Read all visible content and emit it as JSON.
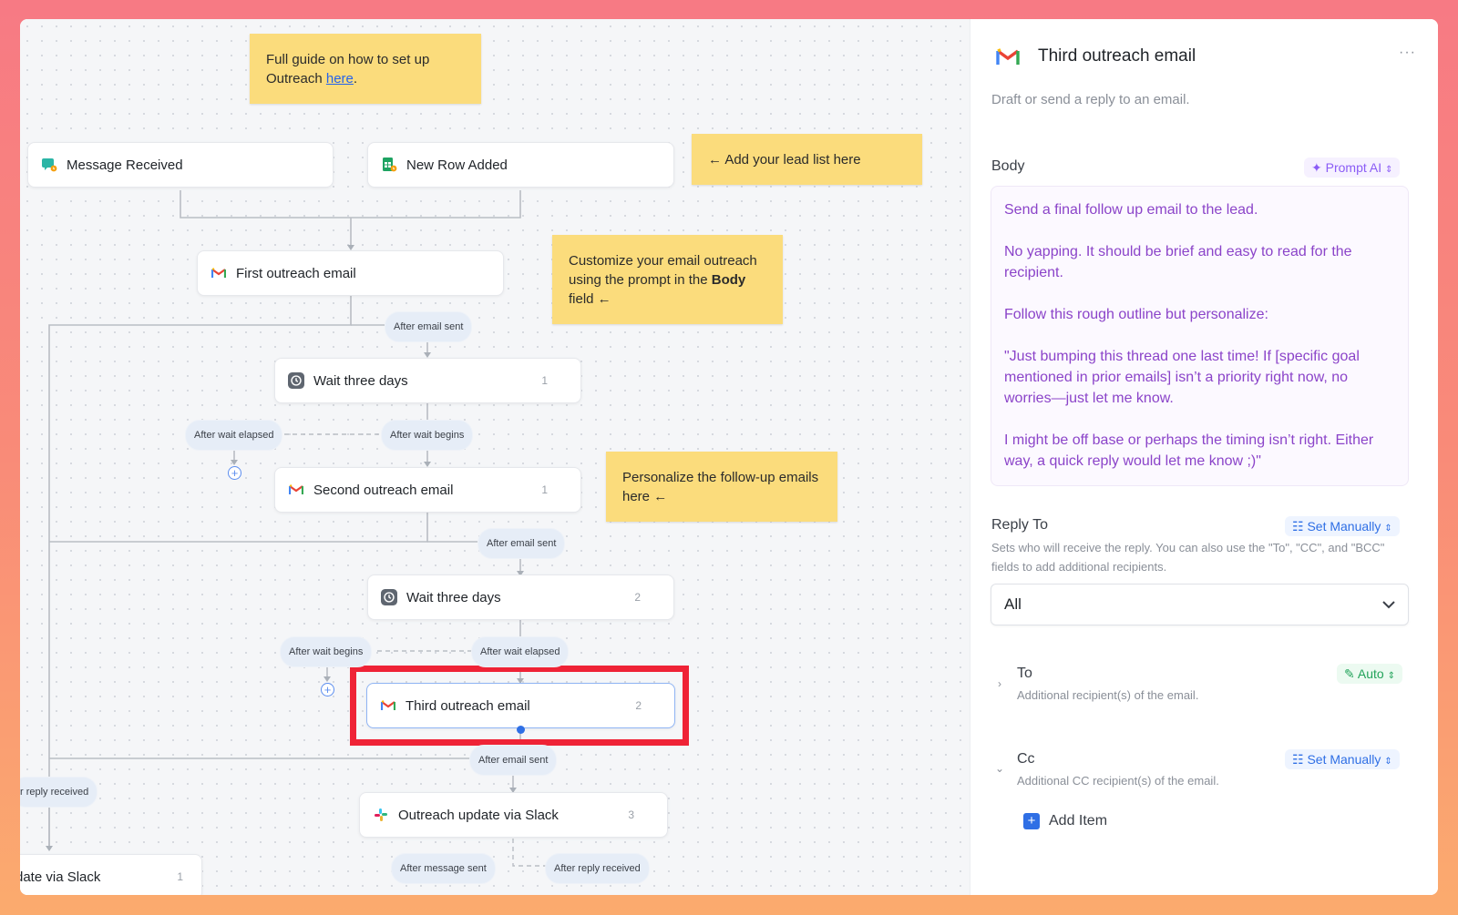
{
  "notes": {
    "guide_text": "Full guide on how to set up Outreach",
    "guide_link": "here",
    "guide_period": ".",
    "lead_list": "← Add your lead list here",
    "customize_pre": "Customize your email outreach using the prompt in the",
    "customize_bold": "Body",
    "customize_post": "field ←",
    "personalize": "Personalize the follow-up emails here ←"
  },
  "nodes": {
    "message_received": "Message Received",
    "new_row_added": "New Row Added",
    "first_outreach": "First outreach email",
    "wait1": "Wait three days",
    "wait1_count": "1",
    "second_outreach": "Second outreach email",
    "second_count": "1",
    "wait2": "Wait three days",
    "wait2_count": "2",
    "third_outreach": "Third outreach email",
    "third_count": "2",
    "slack_update": "Outreach update via Slack",
    "slack_count": "3",
    "slack_partial": "date via Slack",
    "slack_partial_count": "1"
  },
  "pills": {
    "after_email_sent": "After email sent",
    "after_wait_elapsed": "After wait elapsed",
    "after_wait_begins": "After wait begins",
    "reply_received_partial": "r reply received",
    "after_message_sent": "After message sent",
    "after_reply_received": "After reply received"
  },
  "panel": {
    "title": "Third outreach email",
    "more": "···",
    "description": "Draft or send a reply to an email.",
    "body_label": "Body",
    "prompt_ai": "Prompt AI",
    "body_lines": [
      "Send a final follow up email to the lead.",
      "No yapping. It should be brief and easy to read for the recipient.",
      "Follow this rough outline but personalize:",
      "\"Just bumping this thread one last time! If [specific goal mentioned in prior emails] isn’t a priority right now, no worries—just let me know.",
      "I might be off base or perhaps the timing isn’t right. Either way, a quick reply would let me know ;)\""
    ],
    "reply_to_label": "Reply To",
    "set_manually": "Set Manually",
    "reply_to_help": "Sets who will receive the reply. You can also use the \"To\", \"CC\", and \"BCC\" fields to add additional recipients.",
    "reply_to_value": "All",
    "to_label": "To",
    "auto": "Auto",
    "to_help": "Additional recipient(s) of the email.",
    "cc_label": "Cc",
    "cc_help": "Additional CC recipient(s) of the email.",
    "add_item": "Add Item"
  },
  "colors": {
    "note_yellow": "#fbdc7c",
    "highlight_red": "#ef2336",
    "body_purple": "#8b44c9",
    "accent_blue": "#2f6fe5"
  }
}
